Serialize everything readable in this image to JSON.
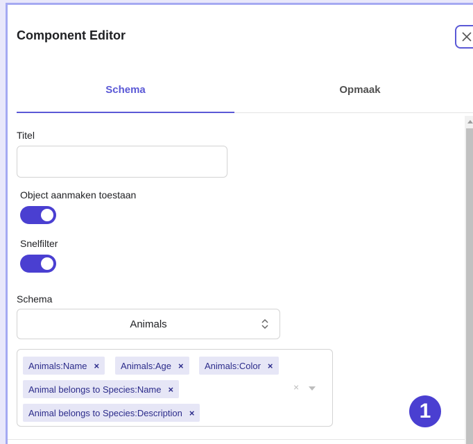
{
  "dialog": {
    "title": "Component Editor",
    "close_icon": "close-icon"
  },
  "tabs": [
    {
      "label": "Schema",
      "active": true
    },
    {
      "label": "Opmaak",
      "active": false
    }
  ],
  "form": {
    "titel_label": "Titel",
    "titel_value": "",
    "object_label": "Object aanmaken toestaan",
    "object_enabled": true,
    "snelfilter_label": "Snelfilter",
    "snelfilter_enabled": true,
    "schema_label": "Schema",
    "schema_value": "Animals",
    "schema_icon": "chevron-up-down-icon",
    "selected_fields": [
      {
        "label": "Animals:Name",
        "remove": "×"
      },
      {
        "label": "Animals:Age",
        "remove": "×"
      },
      {
        "label": "Animals:Color",
        "remove": "×"
      },
      {
        "label": "Animal belongs to Species:Name",
        "remove": "×"
      },
      {
        "label": "Animal belongs to Species:Description",
        "remove": "×"
      }
    ],
    "clear_all": "×"
  },
  "badge": {
    "number": "1"
  },
  "colors": {
    "accent": "#5a58d6",
    "toggle_on": "#4a3fd1",
    "chip_bg": "#e6e6f6",
    "chip_text": "#2b2b8a"
  }
}
